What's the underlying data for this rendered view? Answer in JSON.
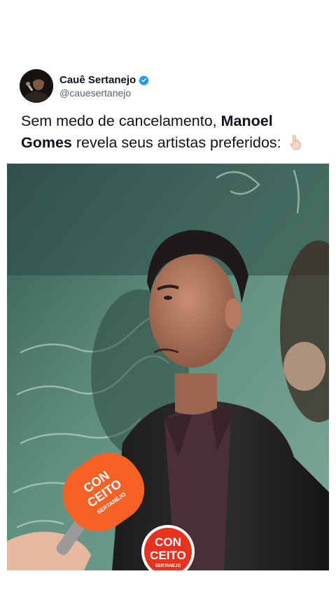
{
  "post": {
    "author": {
      "display_name": "Cauê Sertanejo",
      "handle": "@cauesertanejo",
      "verified": true,
      "verified_color": "#1d9bf0"
    },
    "text": {
      "part1": "Sem medo de cancelamento, ",
      "bold": "Manoel Gomes",
      "part2": " revela seus artistas preferidos:"
    },
    "emoji": "backhand-index-pointing-down"
  },
  "media": {
    "type": "video-frame",
    "mic_flag_text": [
      "CON",
      "CEITO",
      "SERTANEJO"
    ],
    "logo_text": [
      "CON",
      "CEITO",
      "SERTANEJO"
    ],
    "brand_color": "#e8321e"
  }
}
